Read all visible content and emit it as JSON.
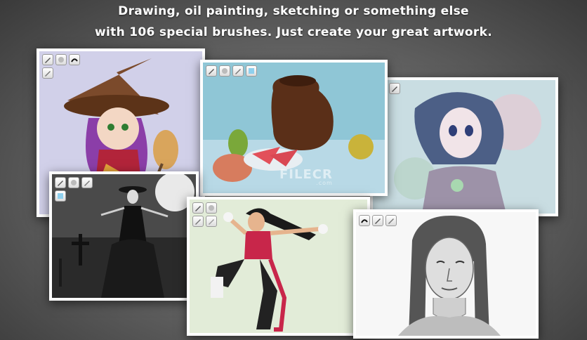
{
  "header": {
    "line1": "Drawing, oil painting, sketching or something else",
    "line2": "with 106 special brushes.  Just create your great artwork."
  },
  "watermark": {
    "brand": "FILECR",
    "domain": ".com"
  },
  "cards": [
    {
      "name": "witch-painting",
      "tool_icons": [
        "pencil-brush-icon",
        "eraser-brush-icon",
        "ink-brush-icon",
        "pencil-brush-icon"
      ]
    },
    {
      "name": "still-life-painting",
      "tool_icons": [
        "pencil-brush-icon",
        "eraser-brush-icon",
        "pencil-brush-icon",
        "blender-brush-icon"
      ]
    },
    {
      "name": "anime-girl-painting",
      "tool_icons": [
        "ink-brush-icon",
        "pencil-brush-icon",
        "pencil-brush-icon"
      ]
    },
    {
      "name": "gothic-night-painting",
      "tool_icons": [
        "pencil-brush-icon",
        "eraser-brush-icon",
        "pencil-brush-icon",
        "blender-brush-icon"
      ]
    },
    {
      "name": "martial-artist-painting",
      "tool_icons": [
        "pencil-brush-icon",
        "eraser-brush-icon",
        "pencil-brush-icon",
        "pencil-brush-icon"
      ]
    },
    {
      "name": "portrait-sketch",
      "tool_icons": [
        "ink-brush-icon",
        "pencil-brush-icon",
        "pencil-brush-icon"
      ]
    }
  ]
}
